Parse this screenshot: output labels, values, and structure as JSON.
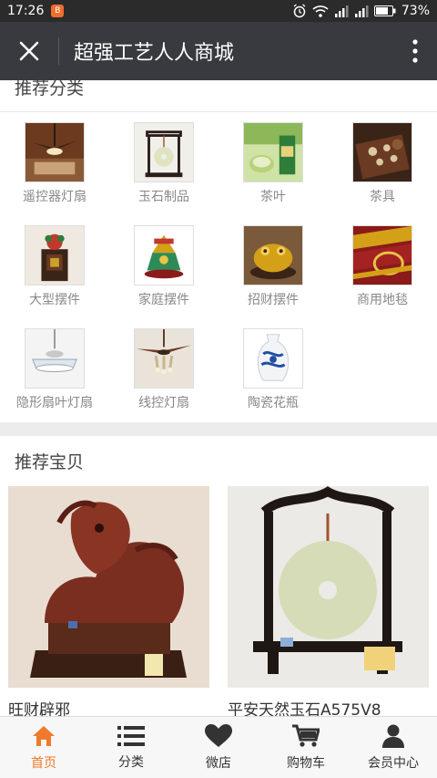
{
  "status_bar": {
    "time": "17:26",
    "battery": "73%",
    "app_badge": "B"
  },
  "header": {
    "title": "超强工艺人人商城"
  },
  "categories_section": {
    "title": "推荐分类"
  },
  "categories": [
    {
      "label": "遥控器灯扇"
    },
    {
      "label": "玉石制品"
    },
    {
      "label": "茶叶"
    },
    {
      "label": "茶具"
    },
    {
      "label": "大型摆件"
    },
    {
      "label": "家庭摆件"
    },
    {
      "label": "招财摆件"
    },
    {
      "label": "商用地毯"
    },
    {
      "label": "隐形扇叶灯扇"
    },
    {
      "label": "线控灯扇"
    },
    {
      "label": "陶瓷花瓶"
    }
  ],
  "products_section": {
    "title": "推荐宝贝"
  },
  "products": [
    {
      "name": "旺财辟邪"
    },
    {
      "name": "平安天然玉石A575V8"
    }
  ],
  "bottom_nav": [
    {
      "label": "首页",
      "icon": "home-icon",
      "active": true
    },
    {
      "label": "分类",
      "icon": "list-icon",
      "active": false
    },
    {
      "label": "微店",
      "icon": "heart-icon",
      "active": false
    },
    {
      "label": "购物车",
      "icon": "cart-icon",
      "active": false
    },
    {
      "label": "会员中心",
      "icon": "user-icon",
      "active": false
    }
  ],
  "colors": {
    "accent": "#f07a2b",
    "title_bar": "#393a3f",
    "status_bar": "#2b2b2b"
  }
}
